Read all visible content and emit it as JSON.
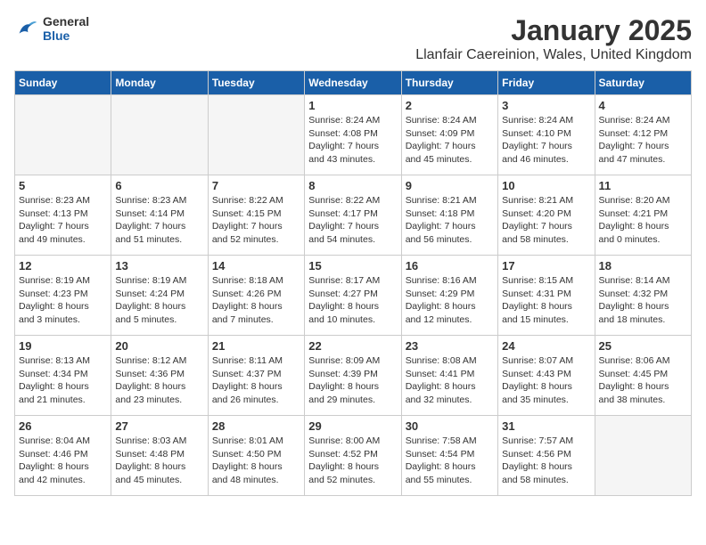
{
  "header": {
    "logo_general": "General",
    "logo_blue": "Blue",
    "month_title": "January 2025",
    "location": "Llanfair Caereinion, Wales, United Kingdom"
  },
  "days_of_week": [
    "Sunday",
    "Monday",
    "Tuesday",
    "Wednesday",
    "Thursday",
    "Friday",
    "Saturday"
  ],
  "weeks": [
    [
      {
        "day": "",
        "info": ""
      },
      {
        "day": "",
        "info": ""
      },
      {
        "day": "",
        "info": ""
      },
      {
        "day": "1",
        "info": "Sunrise: 8:24 AM\nSunset: 4:08 PM\nDaylight: 7 hours\nand 43 minutes."
      },
      {
        "day": "2",
        "info": "Sunrise: 8:24 AM\nSunset: 4:09 PM\nDaylight: 7 hours\nand 45 minutes."
      },
      {
        "day": "3",
        "info": "Sunrise: 8:24 AM\nSunset: 4:10 PM\nDaylight: 7 hours\nand 46 minutes."
      },
      {
        "day": "4",
        "info": "Sunrise: 8:24 AM\nSunset: 4:12 PM\nDaylight: 7 hours\nand 47 minutes."
      }
    ],
    [
      {
        "day": "5",
        "info": "Sunrise: 8:23 AM\nSunset: 4:13 PM\nDaylight: 7 hours\nand 49 minutes."
      },
      {
        "day": "6",
        "info": "Sunrise: 8:23 AM\nSunset: 4:14 PM\nDaylight: 7 hours\nand 51 minutes."
      },
      {
        "day": "7",
        "info": "Sunrise: 8:22 AM\nSunset: 4:15 PM\nDaylight: 7 hours\nand 52 minutes."
      },
      {
        "day": "8",
        "info": "Sunrise: 8:22 AM\nSunset: 4:17 PM\nDaylight: 7 hours\nand 54 minutes."
      },
      {
        "day": "9",
        "info": "Sunrise: 8:21 AM\nSunset: 4:18 PM\nDaylight: 7 hours\nand 56 minutes."
      },
      {
        "day": "10",
        "info": "Sunrise: 8:21 AM\nSunset: 4:20 PM\nDaylight: 7 hours\nand 58 minutes."
      },
      {
        "day": "11",
        "info": "Sunrise: 8:20 AM\nSunset: 4:21 PM\nDaylight: 8 hours\nand 0 minutes."
      }
    ],
    [
      {
        "day": "12",
        "info": "Sunrise: 8:19 AM\nSunset: 4:23 PM\nDaylight: 8 hours\nand 3 minutes."
      },
      {
        "day": "13",
        "info": "Sunrise: 8:19 AM\nSunset: 4:24 PM\nDaylight: 8 hours\nand 5 minutes."
      },
      {
        "day": "14",
        "info": "Sunrise: 8:18 AM\nSunset: 4:26 PM\nDaylight: 8 hours\nand 7 minutes."
      },
      {
        "day": "15",
        "info": "Sunrise: 8:17 AM\nSunset: 4:27 PM\nDaylight: 8 hours\nand 10 minutes."
      },
      {
        "day": "16",
        "info": "Sunrise: 8:16 AM\nSunset: 4:29 PM\nDaylight: 8 hours\nand 12 minutes."
      },
      {
        "day": "17",
        "info": "Sunrise: 8:15 AM\nSunset: 4:31 PM\nDaylight: 8 hours\nand 15 minutes."
      },
      {
        "day": "18",
        "info": "Sunrise: 8:14 AM\nSunset: 4:32 PM\nDaylight: 8 hours\nand 18 minutes."
      }
    ],
    [
      {
        "day": "19",
        "info": "Sunrise: 8:13 AM\nSunset: 4:34 PM\nDaylight: 8 hours\nand 21 minutes."
      },
      {
        "day": "20",
        "info": "Sunrise: 8:12 AM\nSunset: 4:36 PM\nDaylight: 8 hours\nand 23 minutes."
      },
      {
        "day": "21",
        "info": "Sunrise: 8:11 AM\nSunset: 4:37 PM\nDaylight: 8 hours\nand 26 minutes."
      },
      {
        "day": "22",
        "info": "Sunrise: 8:09 AM\nSunset: 4:39 PM\nDaylight: 8 hours\nand 29 minutes."
      },
      {
        "day": "23",
        "info": "Sunrise: 8:08 AM\nSunset: 4:41 PM\nDaylight: 8 hours\nand 32 minutes."
      },
      {
        "day": "24",
        "info": "Sunrise: 8:07 AM\nSunset: 4:43 PM\nDaylight: 8 hours\nand 35 minutes."
      },
      {
        "day": "25",
        "info": "Sunrise: 8:06 AM\nSunset: 4:45 PM\nDaylight: 8 hours\nand 38 minutes."
      }
    ],
    [
      {
        "day": "26",
        "info": "Sunrise: 8:04 AM\nSunset: 4:46 PM\nDaylight: 8 hours\nand 42 minutes."
      },
      {
        "day": "27",
        "info": "Sunrise: 8:03 AM\nSunset: 4:48 PM\nDaylight: 8 hours\nand 45 minutes."
      },
      {
        "day": "28",
        "info": "Sunrise: 8:01 AM\nSunset: 4:50 PM\nDaylight: 8 hours\nand 48 minutes."
      },
      {
        "day": "29",
        "info": "Sunrise: 8:00 AM\nSunset: 4:52 PM\nDaylight: 8 hours\nand 52 minutes."
      },
      {
        "day": "30",
        "info": "Sunrise: 7:58 AM\nSunset: 4:54 PM\nDaylight: 8 hours\nand 55 minutes."
      },
      {
        "day": "31",
        "info": "Sunrise: 7:57 AM\nSunset: 4:56 PM\nDaylight: 8 hours\nand 58 minutes."
      },
      {
        "day": "",
        "info": ""
      }
    ]
  ]
}
